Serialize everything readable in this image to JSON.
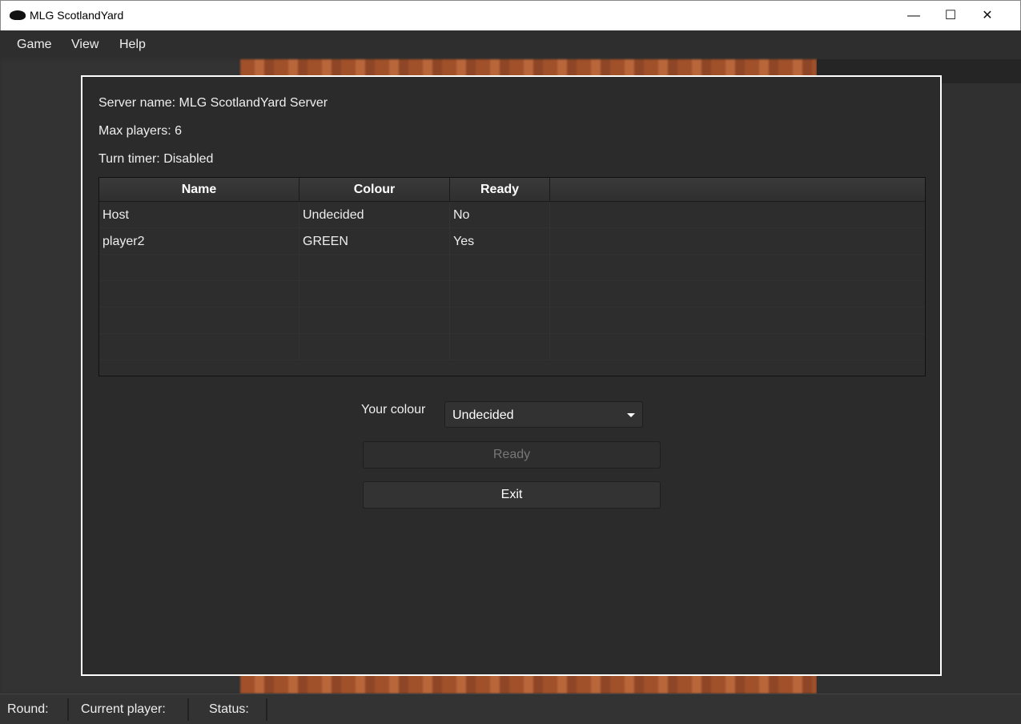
{
  "window": {
    "title": "MLG ScotlandYard",
    "controls": [
      "minimize",
      "maximize",
      "close"
    ]
  },
  "menu": [
    "Game",
    "View",
    "Help"
  ],
  "dialog": {
    "server_name": "Server name: MLG ScotlandYard Server",
    "max_players": "Max players: 6",
    "turn_timer": "Turn timer: Disabled",
    "table": {
      "headers": [
        "Name",
        "Colour",
        "Ready"
      ],
      "rows": [
        [
          "Host",
          "Undecided",
          "No"
        ],
        [
          "player2",
          "GREEN",
          "Yes"
        ]
      ]
    },
    "colour_label": "Your colour",
    "colour_value": "Undecided",
    "ready_label": "Ready",
    "exit_label": "Exit"
  },
  "status": {
    "round": "Round:",
    "current_player": "Current player:",
    "status": "Status:"
  }
}
